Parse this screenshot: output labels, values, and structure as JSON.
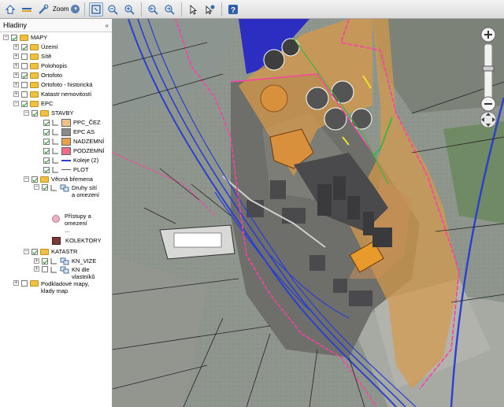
{
  "toolbar": {
    "zoom_label": "Zoom",
    "icons": [
      "home-icon",
      "layers-icon",
      "tools-icon",
      "pan-icon",
      "zoom-out-icon",
      "zoom-in-icon",
      "previous-extent-icon",
      "next-extent-icon",
      "select-arrow-icon",
      "identify-icon",
      "help-icon"
    ]
  },
  "panel": {
    "title": "Hladiny",
    "collapse_glyph": "«"
  },
  "layers": {
    "mapy": "MAPY",
    "uzemi": "Území",
    "site": "Sítě",
    "polohopis": "Polohopis",
    "ortofoto": "Ortofoto",
    "ortofoto_hist": "Ortofoto - historická",
    "katastr_nem": "Katastr nemovitostí",
    "epc": "EPC",
    "stavby": "STAVBY",
    "ppc_cez": "PPC_ČEZ",
    "epc_as": "EPC AS",
    "nadzemni": "NADZEMNÍ",
    "podzemni": "PODZEMNÍ",
    "koleje": "Koleje (2)",
    "plot": "PLOT",
    "vecna": "Věcná břemena",
    "druhy_1": "Druhy sítí",
    "druhy_2": "a omezení",
    "pristupy_1": "Přístupy a",
    "pristupy_2": "omezení",
    "ellipsis": "...",
    "kolektory": "KOLEKTORY",
    "katastr": "KATASTR",
    "kn_vize": "KN_VIZE",
    "kn_dle_1": "KN dle",
    "kn_dle_2": "vlastníků",
    "podkladove_1": "Podkladové mapy,",
    "podkladove_2": "klady map"
  },
  "colors": {
    "accent": "#5a7fb0",
    "ppc_cez": "#f0bf8a",
    "epc_as": "#8a8a8a",
    "nadzemni": "#e7a04c",
    "podzemni": "#f06a8a",
    "koleje": "#2b3fd0",
    "plot": "#5a5a5a",
    "pristupy": "#e7b3c4",
    "kolektory": "#7b3a3a",
    "boundary": "#ff3fa8"
  },
  "map": {
    "nav_up": "▲",
    "nav_down": "▼",
    "nav_left": "◀",
    "nav_right": "▶",
    "plus": "+",
    "minus": "−"
  }
}
